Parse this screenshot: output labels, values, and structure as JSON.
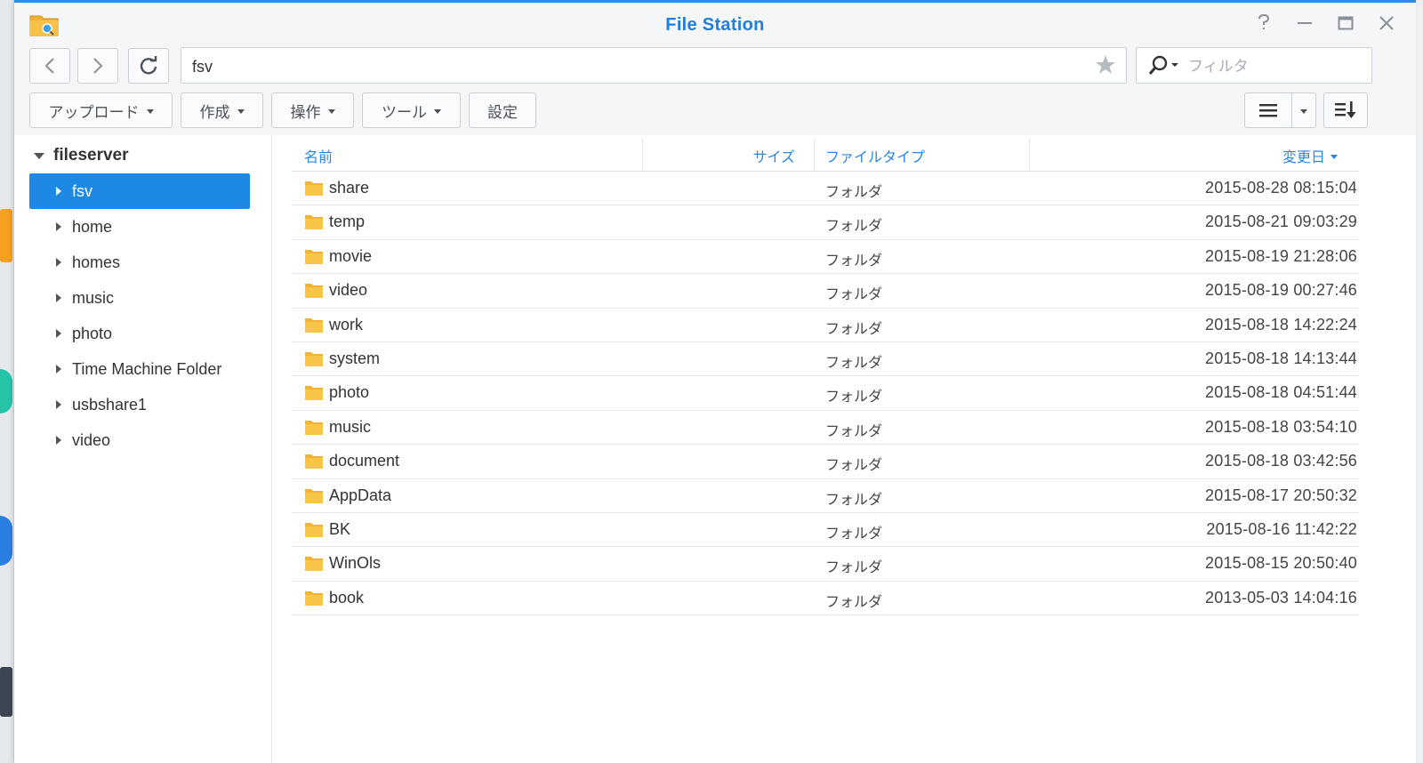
{
  "window": {
    "title": "File Station",
    "accent": "#1e88e5",
    "controls": [
      "help-icon",
      "minimize-icon",
      "maximize-icon",
      "close-icon"
    ]
  },
  "nav": {
    "back_icon": "chevron-left-icon",
    "forward_icon": "chevron-right-icon",
    "refresh_icon": "refresh-icon",
    "path": "fsv",
    "favorite_icon": "star-icon",
    "filter_placeholder": "フィルタ"
  },
  "toolbar": {
    "upload_label": "アップロード",
    "create_label": "作成",
    "action_label": "操作",
    "tools_label": "ツール",
    "settings_label": "設定"
  },
  "sidebar": {
    "root": "fileserver",
    "items": [
      {
        "label": "fsv",
        "selected": true
      },
      {
        "label": "home",
        "selected": false
      },
      {
        "label": "homes",
        "selected": false
      },
      {
        "label": "music",
        "selected": false
      },
      {
        "label": "photo",
        "selected": false
      },
      {
        "label": "Time Machine Folder",
        "selected": false
      },
      {
        "label": "usbshare1",
        "selected": false
      },
      {
        "label": "video",
        "selected": false
      }
    ]
  },
  "list": {
    "columns": {
      "name": "名前",
      "size": "サイズ",
      "type": "ファイルタイプ",
      "modified": "変更日"
    },
    "rows": [
      {
        "name": "share",
        "type": "フォルダ",
        "modified": "2015-08-28 08:15:04"
      },
      {
        "name": "temp",
        "type": "フォルダ",
        "modified": "2015-08-21 09:03:29"
      },
      {
        "name": "movie",
        "type": "フォルダ",
        "modified": "2015-08-19 21:28:06"
      },
      {
        "name": "video",
        "type": "フォルダ",
        "modified": "2015-08-19 00:27:46"
      },
      {
        "name": "work",
        "type": "フォルダ",
        "modified": "2015-08-18 14:22:24"
      },
      {
        "name": "system",
        "type": "フォルダ",
        "modified": "2015-08-18 14:13:44"
      },
      {
        "name": "photo",
        "type": "フォルダ",
        "modified": "2015-08-18 04:51:44"
      },
      {
        "name": "music",
        "type": "フォルダ",
        "modified": "2015-08-18 03:54:10"
      },
      {
        "name": "document",
        "type": "フォルダ",
        "modified": "2015-08-18 03:42:56"
      },
      {
        "name": "AppData",
        "type": "フォルダ",
        "modified": "2015-08-17 20:50:32"
      },
      {
        "name": "BK",
        "type": "フォルダ",
        "modified": "2015-08-16 11:42:22"
      },
      {
        "name": "WinOls",
        "type": "フォルダ",
        "modified": "2015-08-15 20:50:40"
      },
      {
        "name": "book",
        "type": "フォルダ",
        "modified": "2013-05-03 14:04:16"
      }
    ]
  }
}
